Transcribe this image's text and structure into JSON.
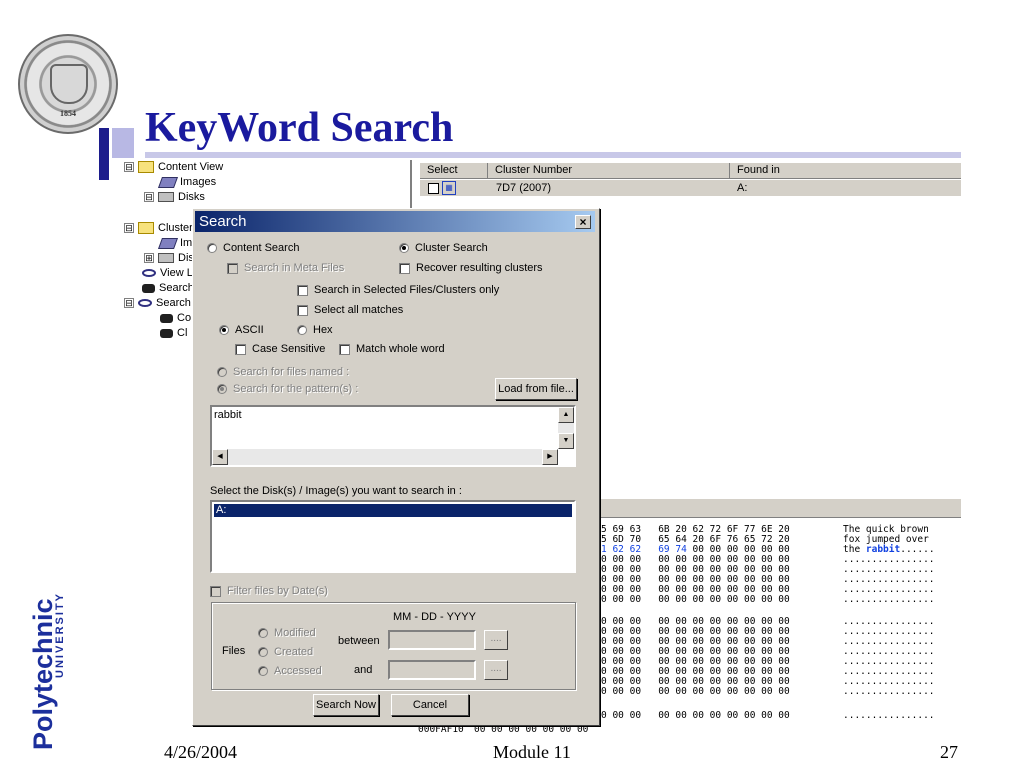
{
  "slide": {
    "title": "KeyWord Search",
    "seal_year": "1854",
    "logo_word": "Polytechnic",
    "logo_sub": "UNIVERSITY",
    "footer_date": "4/26/2004",
    "footer_module": "Module 11",
    "footer_page": "27"
  },
  "tree": {
    "items": [
      {
        "label": "Content View",
        "box": "⊟",
        "icon": "folder-icon"
      },
      {
        "label": "Images",
        "icon": "image-stack-icon"
      },
      {
        "label": "Disks",
        "box": "⊟",
        "icon": "disk-icon"
      },
      {
        "label": "Cluster",
        "box": "⊟",
        "icon": "folder-icon"
      },
      {
        "label": "Im",
        "icon": "image-stack-icon"
      },
      {
        "label": "Dis",
        "box": "⊞",
        "icon": "disk-icon"
      },
      {
        "label": "View L",
        "icon": "eye-icon"
      },
      {
        "label": "Search",
        "icon": "binoculars-icon"
      },
      {
        "label": "Search",
        "box": "⊟",
        "icon": "eye-icon"
      },
      {
        "label": "Co",
        "icon": "binoculars-icon"
      },
      {
        "label": "Cl",
        "icon": "binoculars-icon"
      }
    ]
  },
  "results": {
    "columns": [
      "Select",
      "Cluster Number",
      "Found in"
    ],
    "rows": [
      {
        "cluster": "7D7 (2007)",
        "found_in": "A:"
      }
    ]
  },
  "hex": {
    "lines": [
      {
        "mid": "5 69 63   6B 20 62 72 6F 77 6E 20",
        "ascii": "The quick brown"
      },
      {
        "mid": "5 6D 70   65 64 20 6F 76 65 72 20",
        "ascii": "fox jumped over"
      },
      {
        "mid_pre": "",
        "mid_hl": "1 62 62   69 74",
        "mid_post": " 00 00 00 00 00 00",
        "ascii_pre": "the ",
        "ascii_hl": "rabbit",
        "ascii_post": "......"
      },
      {
        "mid": "0 00 00   00 00 00 00 00 00 00 00",
        "ascii": "................"
      },
      {
        "mid": "0 00 00   00 00 00 00 00 00 00 00",
        "ascii": "................"
      },
      {
        "mid": "0 00 00   00 00 00 00 00 00 00 00",
        "ascii": "................"
      },
      {
        "mid": "0 00 00   00 00 00 00 00 00 00 00",
        "ascii": "................"
      },
      {
        "mid": "0 00 00   00 00 00 00 00 00 00 00",
        "ascii": "................"
      },
      {
        "mid": "0 00 00   00 00 00 00 00 00 00 00",
        "ascii": "................"
      },
      {
        "mid": "0 00 00   00 00 00 00 00 00 00 00",
        "ascii": "................"
      },
      {
        "mid": "0 00 00   00 00 00 00 00 00 00 00",
        "ascii": "................"
      },
      {
        "mid": "0 00 00   00 00 00 00 00 00 00 00",
        "ascii": "................"
      },
      {
        "mid": "0 00 00   00 00 00 00 00 00 00 00",
        "ascii": "................"
      },
      {
        "mid": "0 00 00   00 00 00 00 00 00 00 00",
        "ascii": "................"
      },
      {
        "mid": "0 00 00   00 00 00 00 00 00 00 00",
        "ascii": "................"
      },
      {
        "mid": "0 00 00   00 00 00 00 00 00 00 00",
        "ascii": "................"
      },
      {
        "mid": "0 00 00   00 00 00 00 00 00 00 00",
        "ascii": "................"
      }
    ],
    "bottom_offset": "000FAF10",
    "bottom_mid": "00 00 00 00 00 00 00"
  },
  "dialog": {
    "title": "Search",
    "close": "×",
    "content_search": "Content Search",
    "cluster_search": "Cluster Search",
    "search_meta": "Search in Meta Files",
    "recover_clusters": "Recover resulting clusters",
    "search_selected": "Search in Selected Files/Clusters only",
    "select_all": "Select all matches",
    "ascii": "ASCII",
    "hex": "Hex",
    "case_sensitive": "Case Sensitive",
    "match_whole": "Match whole word",
    "search_files_named": "Search for files named :",
    "search_pattern": "Search for the pattern(s) :",
    "load_from_file": "Load from file...",
    "pattern_value": "rabbit",
    "disk_prompt": "Select the Disk(s) / Image(s) you want to search in :",
    "disk_selected": "A:",
    "filter_by_date": "Filter files by Date(s)",
    "date_format": "MM - DD - YYYY",
    "files_label": "Files",
    "modified": "Modified",
    "created": "Created",
    "accessed": "Accessed",
    "between": "between",
    "and": "and",
    "date_button": "....",
    "search_now": "Search Now",
    "cancel": "Cancel"
  }
}
